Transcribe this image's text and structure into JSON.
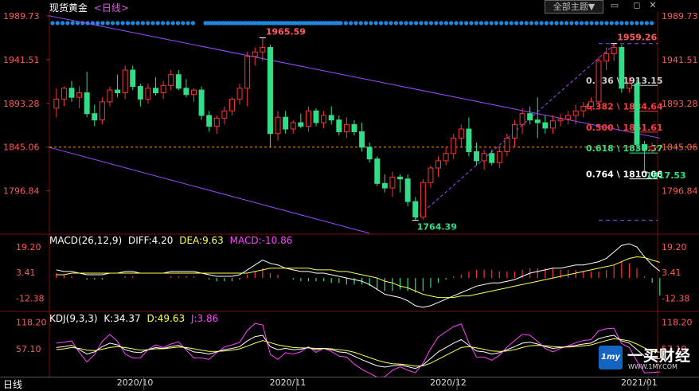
{
  "header": {
    "instrument": "现货黄金",
    "period_link": "<日线>",
    "theme_button": "全部主题▼"
  },
  "window_controls": [
    "minimize-icon",
    "restore-icon",
    "close-icon"
  ],
  "colors": {
    "up": "#ff3333",
    "down": "#33dd88",
    "channel": "#9a4dff",
    "fib": "#ffffff",
    "marker": "#1e88e5",
    "diff": "#ffffff",
    "dea": "#ffff55",
    "k": "#ffffff",
    "d": "#ffff55",
    "j": "#ff44ff"
  },
  "footer": {
    "period": "日线"
  },
  "watermark": {
    "name": "一买财经",
    "url": "WWW.1MY.COM"
  },
  "chart_data": [
    {
      "type": "candlestick",
      "title": "现货黄金",
      "y_ticks": [
        "1989.73",
        "1941.51",
        "1893.28",
        "1845.06",
        "1796.84"
      ],
      "ylim": [
        1750,
        1989.73
      ],
      "x_ticks": [
        "2020/10",
        "2020/11",
        "2020/12",
        "2021/01"
      ],
      "last_price": 1845.06,
      "annotations": {
        "high_1": "1965.59",
        "high_2": "1959.26",
        "low": "1764.39",
        "recent_low": "1817.53"
      },
      "fib_levels": [
        {
          "label": "0.236 \\ 1913.15",
          "price": 1913.15,
          "color": "#cccccc"
        },
        {
          "label": "0.382 \\ 1884.64",
          "price": 1884.64,
          "color": "#ff3b3b"
        },
        {
          "label": "0.500 \\ 1861.61",
          "price": 1861.61,
          "color": "#ff3b3b"
        },
        {
          "label": "0.618 \\ 1838.57",
          "price": 1838.57,
          "color": "#33dd88"
        },
        {
          "label": "0.764 \\ 1810.06",
          "price": 1810.06,
          "color": "#ffffff"
        }
      ],
      "candles": [
        {
          "o": 1888,
          "h": 1910,
          "l": 1878,
          "c": 1898
        },
        {
          "o": 1898,
          "h": 1912,
          "l": 1890,
          "c": 1910
        },
        {
          "o": 1910,
          "h": 1918,
          "l": 1895,
          "c": 1900
        },
        {
          "o": 1900,
          "h": 1912,
          "l": 1888,
          "c": 1905
        },
        {
          "o": 1905,
          "h": 1928,
          "l": 1878,
          "c": 1882
        },
        {
          "o": 1882,
          "h": 1892,
          "l": 1868,
          "c": 1875
        },
        {
          "o": 1875,
          "h": 1900,
          "l": 1870,
          "c": 1895
        },
        {
          "o": 1895,
          "h": 1912,
          "l": 1890,
          "c": 1908
        },
        {
          "o": 1908,
          "h": 1925,
          "l": 1900,
          "c": 1905
        },
        {
          "o": 1905,
          "h": 1935,
          "l": 1898,
          "c": 1930
        },
        {
          "o": 1930,
          "h": 1935,
          "l": 1908,
          "c": 1912
        },
        {
          "o": 1912,
          "h": 1915,
          "l": 1890,
          "c": 1898
        },
        {
          "o": 1898,
          "h": 1915,
          "l": 1893,
          "c": 1910
        },
        {
          "o": 1910,
          "h": 1922,
          "l": 1902,
          "c": 1905
        },
        {
          "o": 1905,
          "h": 1918,
          "l": 1898,
          "c": 1913
        },
        {
          "o": 1913,
          "h": 1930,
          "l": 1908,
          "c": 1925
        },
        {
          "o": 1925,
          "h": 1930,
          "l": 1908,
          "c": 1910
        },
        {
          "o": 1910,
          "h": 1920,
          "l": 1900,
          "c": 1903
        },
        {
          "o": 1903,
          "h": 1910,
          "l": 1895,
          "c": 1908
        },
        {
          "o": 1908,
          "h": 1912,
          "l": 1875,
          "c": 1880
        },
        {
          "o": 1880,
          "h": 1885,
          "l": 1862,
          "c": 1868
        },
        {
          "o": 1868,
          "h": 1880,
          "l": 1860,
          "c": 1877
        },
        {
          "o": 1877,
          "h": 1890,
          "l": 1870,
          "c": 1885
        },
        {
          "o": 1885,
          "h": 1900,
          "l": 1880,
          "c": 1898
        },
        {
          "o": 1898,
          "h": 1915,
          "l": 1892,
          "c": 1910
        },
        {
          "o": 1910,
          "h": 1950,
          "l": 1890,
          "c": 1945
        },
        {
          "o": 1945,
          "h": 1955,
          "l": 1935,
          "c": 1950
        },
        {
          "o": 1950,
          "h": 1965.59,
          "l": 1940,
          "c": 1955
        },
        {
          "o": 1955,
          "h": 1958,
          "l": 1845,
          "c": 1860
        },
        {
          "o": 1860,
          "h": 1885,
          "l": 1852,
          "c": 1878
        },
        {
          "o": 1878,
          "h": 1885,
          "l": 1860,
          "c": 1865
        },
        {
          "o": 1865,
          "h": 1875,
          "l": 1860,
          "c": 1872
        },
        {
          "o": 1872,
          "h": 1882,
          "l": 1866,
          "c": 1868
        },
        {
          "o": 1868,
          "h": 1890,
          "l": 1862,
          "c": 1885
        },
        {
          "o": 1885,
          "h": 1888,
          "l": 1868,
          "c": 1872
        },
        {
          "o": 1872,
          "h": 1885,
          "l": 1866,
          "c": 1880
        },
        {
          "o": 1880,
          "h": 1890,
          "l": 1870,
          "c": 1875
        },
        {
          "o": 1875,
          "h": 1880,
          "l": 1858,
          "c": 1862
        },
        {
          "o": 1862,
          "h": 1878,
          "l": 1855,
          "c": 1870
        },
        {
          "o": 1870,
          "h": 1875,
          "l": 1858,
          "c": 1862
        },
        {
          "o": 1862,
          "h": 1872,
          "l": 1840,
          "c": 1845
        },
        {
          "o": 1845,
          "h": 1850,
          "l": 1828,
          "c": 1832
        },
        {
          "o": 1832,
          "h": 1835,
          "l": 1802,
          "c": 1805
        },
        {
          "o": 1805,
          "h": 1815,
          "l": 1795,
          "c": 1800
        },
        {
          "o": 1800,
          "h": 1818,
          "l": 1790,
          "c": 1812
        },
        {
          "o": 1812,
          "h": 1815,
          "l": 1795,
          "c": 1810
        },
        {
          "o": 1810,
          "h": 1815,
          "l": 1780,
          "c": 1785
        },
        {
          "o": 1785,
          "h": 1790,
          "l": 1764.39,
          "c": 1768
        },
        {
          "o": 1768,
          "h": 1810,
          "l": 1765,
          "c": 1806
        },
        {
          "o": 1806,
          "h": 1825,
          "l": 1800,
          "c": 1822
        },
        {
          "o": 1822,
          "h": 1835,
          "l": 1812,
          "c": 1830
        },
        {
          "o": 1830,
          "h": 1845,
          "l": 1825,
          "c": 1838
        },
        {
          "o": 1838,
          "h": 1860,
          "l": 1832,
          "c": 1855
        },
        {
          "o": 1855,
          "h": 1870,
          "l": 1845,
          "c": 1865
        },
        {
          "o": 1865,
          "h": 1878,
          "l": 1835,
          "c": 1840
        },
        {
          "o": 1840,
          "h": 1850,
          "l": 1825,
          "c": 1830
        },
        {
          "o": 1830,
          "h": 1842,
          "l": 1820,
          "c": 1838
        },
        {
          "o": 1838,
          "h": 1842,
          "l": 1825,
          "c": 1828
        },
        {
          "o": 1828,
          "h": 1845,
          "l": 1822,
          "c": 1840
        },
        {
          "o": 1840,
          "h": 1860,
          "l": 1835,
          "c": 1855
        },
        {
          "o": 1855,
          "h": 1875,
          "l": 1845,
          "c": 1870
        },
        {
          "o": 1870,
          "h": 1888,
          "l": 1860,
          "c": 1882
        },
        {
          "o": 1882,
          "h": 1890,
          "l": 1870,
          "c": 1875
        },
        {
          "o": 1875,
          "h": 1900,
          "l": 1855,
          "c": 1872
        },
        {
          "o": 1872,
          "h": 1880,
          "l": 1860,
          "c": 1866
        },
        {
          "o": 1866,
          "h": 1880,
          "l": 1860,
          "c": 1874
        },
        {
          "o": 1874,
          "h": 1882,
          "l": 1868,
          "c": 1876
        },
        {
          "o": 1876,
          "h": 1885,
          "l": 1870,
          "c": 1880
        },
        {
          "o": 1880,
          "h": 1892,
          "l": 1870,
          "c": 1885
        },
        {
          "o": 1885,
          "h": 1895,
          "l": 1878,
          "c": 1890
        },
        {
          "o": 1890,
          "h": 1900,
          "l": 1885,
          "c": 1895
        },
        {
          "o": 1895,
          "h": 1945,
          "l": 1890,
          "c": 1940
        },
        {
          "o": 1940,
          "h": 1955,
          "l": 1930,
          "c": 1948
        },
        {
          "o": 1948,
          "h": 1959.26,
          "l": 1940,
          "c": 1955
        },
        {
          "o": 1955,
          "h": 1958,
          "l": 1905,
          "c": 1910
        },
        {
          "o": 1910,
          "h": 1922,
          "l": 1905,
          "c": 1915
        },
        {
          "o": 1915,
          "h": 1920,
          "l": 1840,
          "c": 1848
        },
        {
          "o": 1848,
          "h": 1852,
          "l": 1817.53,
          "c": 1842
        },
        {
          "o": 1842,
          "h": 1850,
          "l": 1838,
          "c": 1846
        }
      ]
    },
    {
      "type": "macd",
      "title": "MACD(26,12,9)",
      "diff_label": "DIFF:4.20",
      "dea_label": "DEA:9.63",
      "macd_label": "MACD:-10.86",
      "y_ticks": [
        "19.20",
        "3.41",
        "-12.38"
      ],
      "ylim": [
        -20,
        24
      ],
      "diff": [
        5,
        4,
        4,
        3,
        2,
        2,
        2,
        3,
        3,
        4,
        4,
        3,
        3,
        3,
        3,
        4,
        4,
        4,
        4,
        3,
        2,
        1,
        1,
        1,
        2,
        5,
        8,
        11,
        9,
        8,
        6,
        5,
        4,
        4,
        3,
        3,
        2,
        1,
        0,
        -1,
        -2,
        -4,
        -7,
        -10,
        -11,
        -12,
        -14,
        -17,
        -18,
        -17,
        -15,
        -13,
        -11,
        -9,
        -7,
        -5,
        -4,
        -3,
        -3,
        -2,
        -1,
        1,
        3,
        4,
        5,
        6,
        6,
        7,
        8,
        8,
        9,
        10,
        12,
        16,
        20,
        21,
        19,
        13,
        8,
        4.2
      ],
      "dea": [
        2,
        2,
        3,
        3,
        3,
        3,
        3,
        3,
        3,
        3,
        3,
        3,
        3,
        3,
        3,
        3,
        3,
        3,
        3,
        3,
        3,
        3,
        3,
        3,
        3,
        3,
        4,
        5,
        6,
        6,
        6,
        6,
        6,
        6,
        5,
        5,
        5,
        4,
        4,
        3,
        2,
        1,
        0,
        -2,
        -3,
        -5,
        -6,
        -8,
        -10,
        -11,
        -12,
        -12,
        -12,
        -11,
        -11,
        -10,
        -9,
        -8,
        -7,
        -6,
        -5,
        -4,
        -3,
        -2,
        -1,
        0,
        1,
        2,
        3,
        4,
        5,
        6,
        7,
        8,
        10,
        12,
        13,
        12.5,
        11,
        9.63
      ],
      "macd": [
        3,
        2,
        1,
        0,
        -1,
        -1,
        -1,
        0,
        0,
        1,
        1,
        0,
        0,
        0,
        0,
        1,
        1,
        1,
        1,
        0,
        -1,
        -2,
        -2,
        -2,
        -1,
        2,
        4,
        6,
        3,
        2,
        0,
        -1,
        -2,
        -2,
        -2,
        -2,
        -3,
        -3,
        -4,
        -4,
        -4,
        -5,
        -7,
        -8,
        -8,
        -7,
        -8,
        -9,
        -8,
        -6,
        -3,
        -1,
        1,
        2,
        4,
        5,
        5,
        5,
        4,
        4,
        4,
        5,
        6,
        6,
        6,
        6,
        5,
        5,
        5,
        4,
        4,
        4,
        5,
        8,
        10,
        9,
        6,
        1,
        -3,
        -10.86
      ]
    },
    {
      "type": "kdj",
      "title": "KDJ(9,3,3)",
      "k_label": "K:34.37",
      "d_label": "D:49.63",
      "j_label": "J:3.86",
      "y_ticks": [
        "118.20",
        "57.10"
      ],
      "ylim": [
        -5,
        130
      ],
      "k": [
        60,
        62,
        65,
        55,
        45,
        50,
        62,
        70,
        66,
        55,
        50,
        48,
        55,
        60,
        58,
        62,
        65,
        58,
        50,
        48,
        45,
        50,
        55,
        58,
        62,
        75,
        85,
        88,
        62,
        55,
        58,
        55,
        56,
        60,
        55,
        58,
        55,
        50,
        48,
        40,
        32,
        25,
        18,
        15,
        18,
        20,
        16,
        12,
        20,
        35,
        50,
        60,
        70,
        78,
        65,
        52,
        50,
        45,
        48,
        55,
        62,
        70,
        72,
        68,
        62,
        58,
        60,
        62,
        65,
        68,
        70,
        80,
        85,
        88,
        75,
        70,
        55,
        40,
        35,
        34.37
      ],
      "d": [
        55,
        57,
        60,
        58,
        54,
        53,
        56,
        60,
        62,
        60,
        57,
        54,
        55,
        57,
        57,
        59,
        61,
        60,
        57,
        54,
        51,
        51,
        52,
        54,
        57,
        63,
        70,
        76,
        71,
        66,
        63,
        60,
        59,
        59,
        58,
        58,
        57,
        55,
        53,
        49,
        43,
        37,
        31,
        26,
        23,
        22,
        20,
        17,
        18,
        24,
        33,
        42,
        51,
        60,
        62,
        59,
        56,
        52,
        51,
        52,
        55,
        60,
        64,
        65,
        64,
        62,
        61,
        61,
        62,
        64,
        66,
        71,
        76,
        80,
        78,
        75,
        68,
        59,
        51,
        49.63
      ],
      "j": [
        70,
        72,
        75,
        49,
        27,
        44,
        74,
        90,
        74,
        45,
        36,
        36,
        55,
        66,
        60,
        68,
        73,
        54,
        36,
        36,
        33,
        48,
        61,
        66,
        72,
        99,
        115,
        112,
        44,
        33,
        48,
        45,
        50,
        62,
        49,
        58,
        51,
        40,
        38,
        22,
        10,
        1,
        -8,
        -7,
        8,
        16,
        8,
        2,
        24,
        57,
        84,
        96,
        108,
        114,
        71,
        38,
        38,
        31,
        42,
        61,
        76,
        90,
        88,
        74,
        58,
        50,
        58,
        64,
        71,
        76,
        78,
        98,
        103,
        104,
        69,
        60,
        29,
        2,
        3,
        3.86
      ]
    }
  ]
}
